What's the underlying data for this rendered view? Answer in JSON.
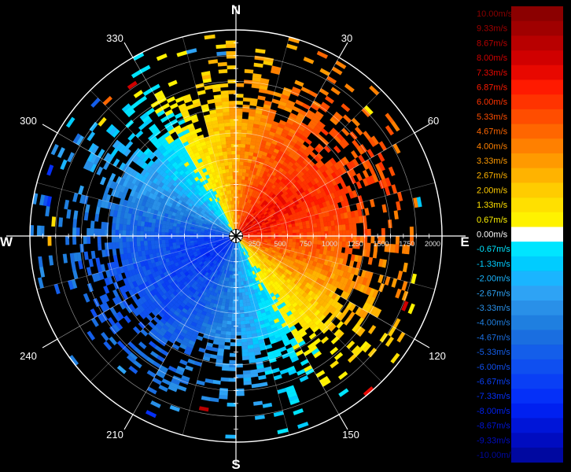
{
  "chart_data": {
    "type": "polar-heatmap",
    "title": "",
    "compass": {
      "north": "N",
      "east": "E",
      "south": "S",
      "west": "W"
    },
    "bearing_labels": [
      "30",
      "60",
      "120",
      "150",
      "210",
      "240",
      "300",
      "330"
    ],
    "range_ticks": [
      "250",
      "500",
      "750",
      "1000",
      "1250",
      "1500",
      "1750",
      "2000"
    ],
    "range_max": 2000,
    "ring_step": 250,
    "radial_step_deg": 15,
    "approaching_direction_deg": 60,
    "sector_boundary_deg": [
      111,
      291
    ],
    "color_scale": [
      {
        "label": "10.00m/s",
        "value": 10.0,
        "color": "#8b0000"
      },
      {
        "label": "9.33m/s",
        "value": 9.33,
        "color": "#a00000"
      },
      {
        "label": "8.67m/s",
        "value": 8.67,
        "color": "#b80000"
      },
      {
        "label": "8.00m/s",
        "value": 8.0,
        "color": "#d00000"
      },
      {
        "label": "7.33m/s",
        "value": 7.33,
        "color": "#e80800"
      },
      {
        "label": "6.87m/s",
        "value": 6.87,
        "color": "#ff1a00"
      },
      {
        "label": "6.00m/s",
        "value": 6.0,
        "color": "#ff3300"
      },
      {
        "label": "5.33m/s",
        "value": 5.33,
        "color": "#ff4d00"
      },
      {
        "label": "4.67m/s",
        "value": 4.67,
        "color": "#ff6600"
      },
      {
        "label": "4.00m/s",
        "value": 4.0,
        "color": "#ff8000"
      },
      {
        "label": "3.33m/s",
        "value": 3.33,
        "color": "#ff9a00"
      },
      {
        "label": "2.67m/s",
        "value": 2.67,
        "color": "#ffb300"
      },
      {
        "label": "2.00m/s",
        "value": 2.0,
        "color": "#ffcc00"
      },
      {
        "label": "1.33m/s",
        "value": 1.33,
        "color": "#ffe000"
      },
      {
        "label": "0.67m/s",
        "value": 0.67,
        "color": "#fff200"
      },
      {
        "label": "0.00m/s",
        "value": 0.0,
        "color": "#ffffff"
      },
      {
        "label": "-0.67m/s",
        "value": -0.67,
        "color": "#00e5ff"
      },
      {
        "label": "-1.33m/s",
        "value": -1.33,
        "color": "#00ccff"
      },
      {
        "label": "-2.00m/s",
        "value": -2.0,
        "color": "#1ab5ff"
      },
      {
        "label": "-2.67m/s",
        "value": -2.67,
        "color": "#2ea3f5"
      },
      {
        "label": "-3.33m/s",
        "value": -3.33,
        "color": "#2990e8"
      },
      {
        "label": "-4.00m/s",
        "value": -4.0,
        "color": "#1f7fe0"
      },
      {
        "label": "-4.67m/s",
        "value": -4.67,
        "color": "#1a6ee0"
      },
      {
        "label": "-5.33m/s",
        "value": -5.33,
        "color": "#145eea"
      },
      {
        "label": "-6.00m/s",
        "value": -6.0,
        "color": "#0f4ff0"
      },
      {
        "label": "-6.67m/s",
        "value": -6.67,
        "color": "#0a3ff5"
      },
      {
        "label": "-7.33m/s",
        "value": -7.33,
        "color": "#0530f8"
      },
      {
        "label": "-8.00m/s",
        "value": -8.0,
        "color": "#0020f0"
      },
      {
        "label": "-8.67m/s",
        "value": -8.67,
        "color": "#0015d8"
      },
      {
        "label": "-9.33m/s",
        "value": -9.33,
        "color": "#000cc0"
      },
      {
        "label": "-10.00m/s",
        "value": -10.0,
        "color": "#0008a0"
      }
    ]
  }
}
